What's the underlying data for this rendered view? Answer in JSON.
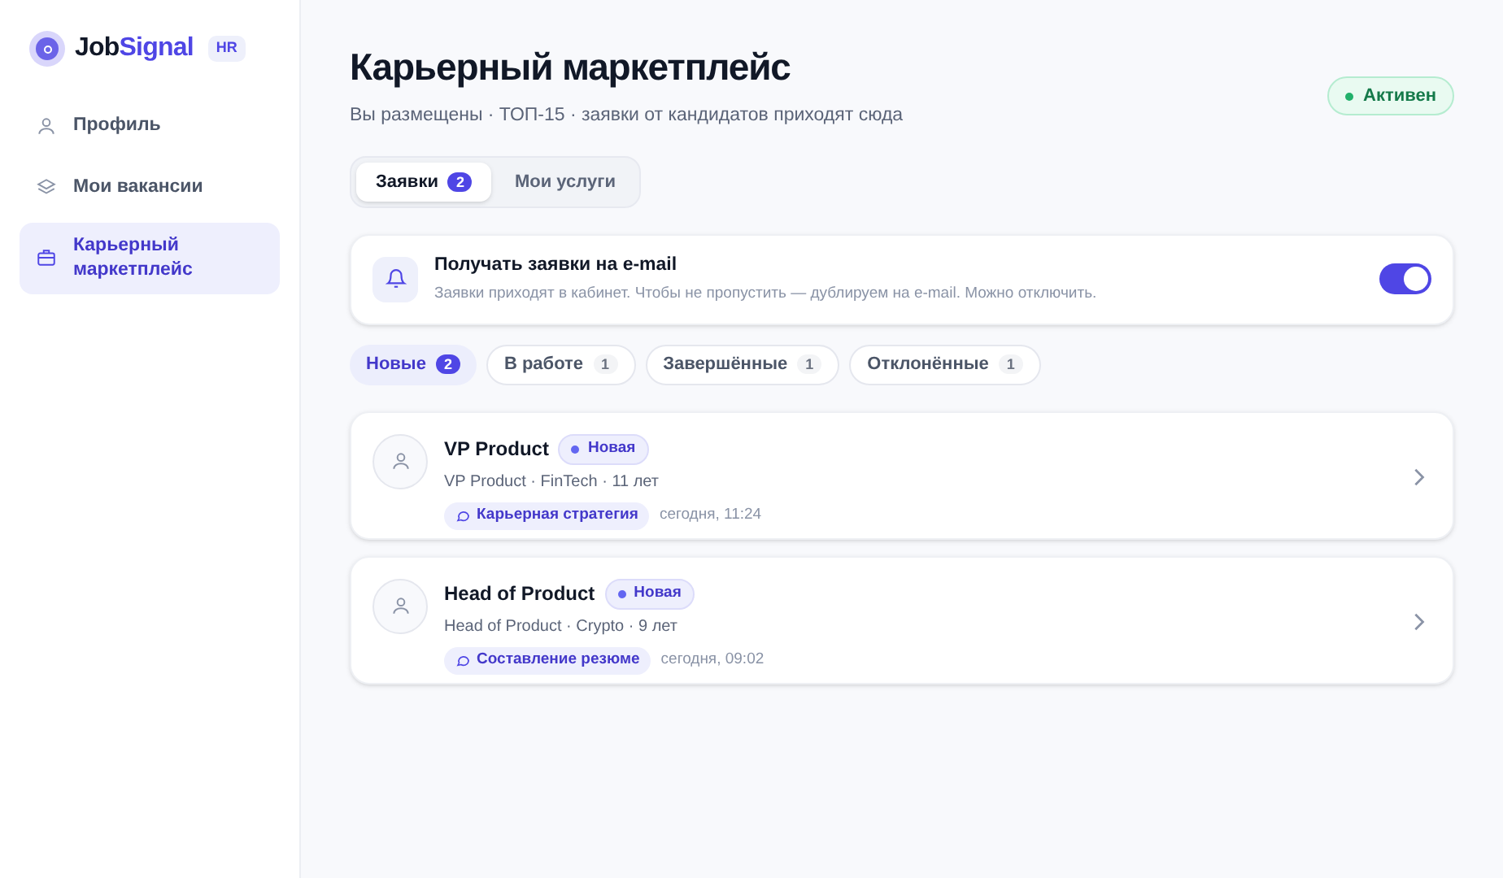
{
  "sidebar": {
    "logo": {
      "first": "Job",
      "second": "Signal"
    },
    "badge": "HR",
    "items": [
      {
        "label": "Профиль",
        "selected": false
      },
      {
        "label": "Мои вакансии",
        "selected": false
      },
      {
        "label": "Карьерный маркетплейс",
        "selected": true
      }
    ]
  },
  "header": {
    "title": "Карьерный маркетплейс",
    "subtitle": "Вы размещены · ТОП-15 · заявки от кандидатов приходят сюда",
    "status": "Активен"
  },
  "tabs": [
    {
      "label": "Заявки",
      "count": "2",
      "selected": true
    },
    {
      "label": "Мои услуги",
      "selected": false
    }
  ],
  "email_setting": {
    "title": "Получать заявки на e-mail",
    "description": "Заявки приходят в кабинет. Чтобы не пропустить — дублируем на e-mail. Можно отключить.",
    "on": true
  },
  "filters": [
    {
      "label": "Новые",
      "count": "2",
      "selected": true
    },
    {
      "label": "В работе",
      "count": "1",
      "selected": false
    },
    {
      "label": "Завершённые",
      "count": "1",
      "selected": false
    },
    {
      "label": "Отклонённые",
      "count": "1",
      "selected": false
    }
  ],
  "requests": [
    {
      "name": "VP Product",
      "status": "Новая",
      "details": "VP Product · FinTech · 11 лет",
      "service": "Карьерная стратегия",
      "time": "сегодня, 11:24"
    },
    {
      "name": "Head of Product",
      "status": "Новая",
      "details": "Head of Product · Crypto · 9 лет",
      "service": "Составление резюме",
      "time": "сегодня, 09:02"
    }
  ]
}
